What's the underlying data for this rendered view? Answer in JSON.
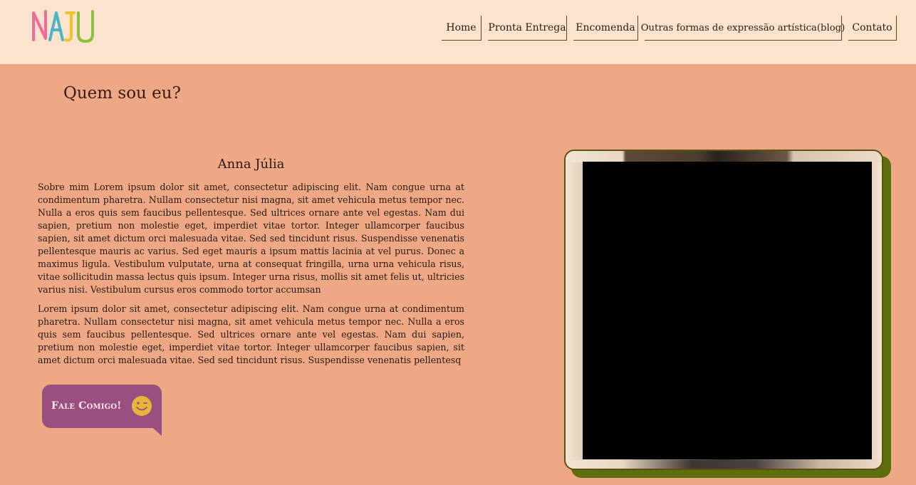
{
  "header": {
    "logo_text": "NAJU",
    "nav": [
      {
        "label": "Home"
      },
      {
        "label": "Pronta Entrega"
      },
      {
        "label": "Encomenda"
      },
      {
        "label": "Outras formas de expressão artística(blog)"
      },
      {
        "label": "Contato"
      }
    ]
  },
  "about": {
    "heading": "Quem sou eu?",
    "name": "Anna Júlia",
    "paragraph1": "Sobre mim Lorem ipsum dolor sit amet, consectetur adipiscing elit. Nam congue urna at condimentum pharetra. Nullam consectetur nisi magna, sit amet vehicula metus tempor nec. Nulla a eros quis sem faucibus pellentesque. Sed ultrices ornare ante vel egestas. Nam dui sapien, pretium non molestie eget, imperdiet vitae tortor. Integer ullamcorper faucibus sapien, sit amet dictum orci malesuada vitae. Sed sed tincidunt risus. Suspendisse venenatis pellentesque mauris ac varius. Sed eget mauris a ipsum mattis lacinia at vel purus. Donec a maximus ligula. Vestibulum vulputate, urna at consequat fringilla, urna urna vehicula risus, vitae sollicitudin massa lectus quis ipsum. Integer urna risus, mollis sit amet felis ut, ultricies varius nisi. Vestibulum cursus eros commodo tortor accumsan",
    "paragraph2": "Lorem ipsum dolor sit amet, consectetur adipiscing elit. Nam congue urna at condimentum pharetra. Nullam consectetur nisi magna, sit amet vehicula metus tempor nec. Nulla a eros quis sem faucibus pellentesque. Sed ultrices ornare ante vel egestas. Nam dui sapien, pretium non molestie eget, imperdiet vitae tortor. Integer ullamcorper faucibus sapien, sit amet dictum orci malesuada vitae. Sed sed tincidunt risus. Suspendisse venenatis pellentesq",
    "cta_label": "Fale Comigo!",
    "cta_icon": "smile-icon"
  },
  "colors": {
    "header_bg": "#fbe3cd",
    "page_bg": "#eea886",
    "nav_border": "#5d4e12",
    "cta_bg": "#9b4f80",
    "photo_shadow": "#5d6e0f"
  }
}
